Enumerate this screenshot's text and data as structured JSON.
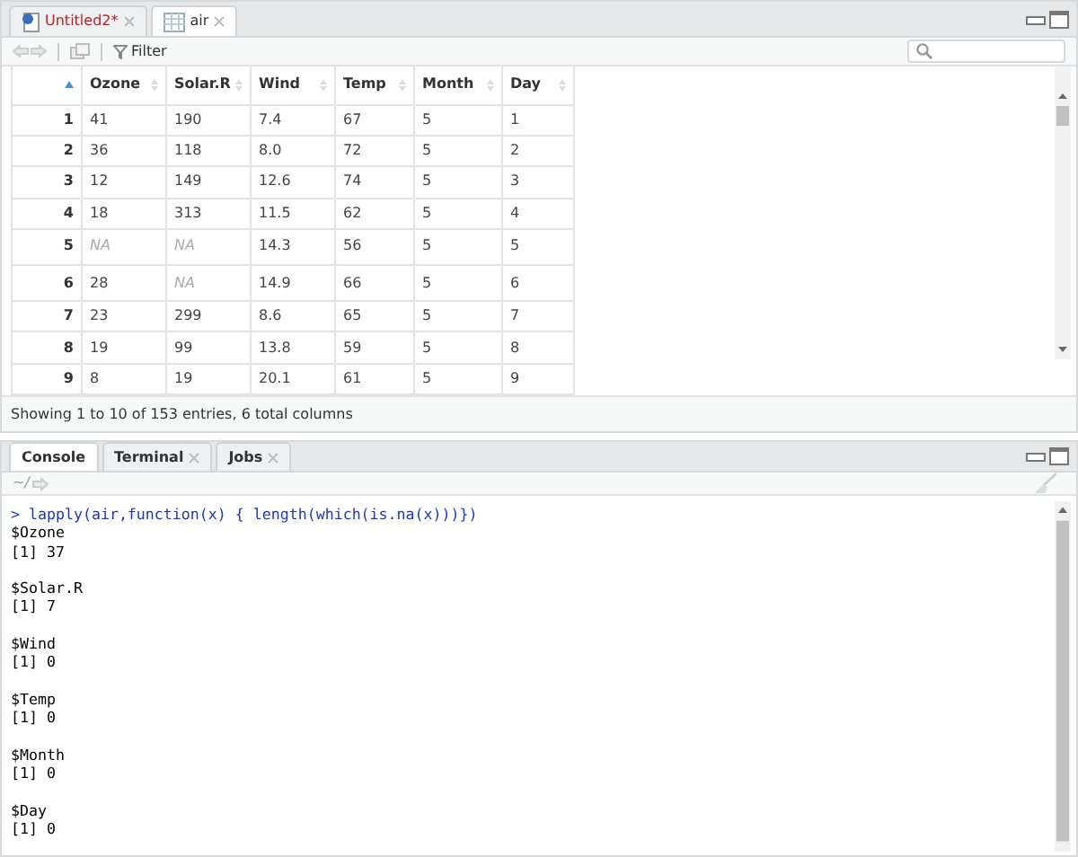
{
  "editor": {
    "tabs": [
      {
        "label": "Untitled2*",
        "kind": "script",
        "modified": true,
        "selected": false
      },
      {
        "label": "air",
        "kind": "data",
        "modified": false,
        "selected": true
      }
    ],
    "toolbar": {
      "filter_label": "Filter"
    },
    "table": {
      "index_column": {
        "sorted": true
      },
      "columns": [
        {
          "label": "Ozone",
          "sorted": false
        },
        {
          "label": "Solar.R",
          "sorted": false
        },
        {
          "label": "Wind",
          "sorted": false
        },
        {
          "label": "Temp",
          "sorted": false
        },
        {
          "label": "Month",
          "sorted": false
        },
        {
          "label": "Day",
          "sorted": false
        }
      ],
      "rows": [
        {
          "index": "1",
          "cells": [
            {
              "value": "41",
              "missing": false
            },
            {
              "value": "190",
              "missing": false
            },
            {
              "value": "7.4",
              "missing": false
            },
            {
              "value": "67",
              "missing": false
            },
            {
              "value": "5",
              "missing": false
            },
            {
              "value": "1",
              "missing": false
            }
          ]
        },
        {
          "index": "2",
          "cells": [
            {
              "value": "36",
              "missing": false
            },
            {
              "value": "118",
              "missing": false
            },
            {
              "value": "8.0",
              "missing": false
            },
            {
              "value": "72",
              "missing": false
            },
            {
              "value": "5",
              "missing": false
            },
            {
              "value": "2",
              "missing": false
            }
          ]
        },
        {
          "index": "3",
          "cells": [
            {
              "value": "12",
              "missing": false
            },
            {
              "value": "149",
              "missing": false
            },
            {
              "value": "12.6",
              "missing": false
            },
            {
              "value": "74",
              "missing": false
            },
            {
              "value": "5",
              "missing": false
            },
            {
              "value": "3",
              "missing": false
            }
          ]
        },
        {
          "index": "4",
          "cells": [
            {
              "value": "18",
              "missing": false
            },
            {
              "value": "313",
              "missing": false
            },
            {
              "value": "11.5",
              "missing": false
            },
            {
              "value": "62",
              "missing": false
            },
            {
              "value": "5",
              "missing": false
            },
            {
              "value": "4",
              "missing": false
            }
          ]
        },
        {
          "index": "5",
          "cells": [
            {
              "value": "NA",
              "missing": true
            },
            {
              "value": "NA",
              "missing": true
            },
            {
              "value": "14.3",
              "missing": false
            },
            {
              "value": "56",
              "missing": false
            },
            {
              "value": "5",
              "missing": false
            },
            {
              "value": "5",
              "missing": false
            }
          ]
        },
        {
          "index": "6",
          "cells": [
            {
              "value": "28",
              "missing": false
            },
            {
              "value": "NA",
              "missing": true
            },
            {
              "value": "14.9",
              "missing": false
            },
            {
              "value": "66",
              "missing": false
            },
            {
              "value": "5",
              "missing": false
            },
            {
              "value": "6",
              "missing": false
            }
          ]
        },
        {
          "index": "7",
          "cells": [
            {
              "value": "23",
              "missing": false
            },
            {
              "value": "299",
              "missing": false
            },
            {
              "value": "8.6",
              "missing": false
            },
            {
              "value": "65",
              "missing": false
            },
            {
              "value": "5",
              "missing": false
            },
            {
              "value": "7",
              "missing": false
            }
          ]
        },
        {
          "index": "8",
          "cells": [
            {
              "value": "19",
              "missing": false
            },
            {
              "value": "99",
              "missing": false
            },
            {
              "value": "13.8",
              "missing": false
            },
            {
              "value": "59",
              "missing": false
            },
            {
              "value": "5",
              "missing": false
            },
            {
              "value": "8",
              "missing": false
            }
          ]
        },
        {
          "index": "9",
          "cells": [
            {
              "value": "8",
              "missing": false
            },
            {
              "value": "19",
              "missing": false
            },
            {
              "value": "20.1",
              "missing": false
            },
            {
              "value": "61",
              "missing": false
            },
            {
              "value": "5",
              "missing": false
            },
            {
              "value": "9",
              "missing": false
            }
          ]
        }
      ]
    },
    "footer": "Showing 1 to 10 of 153 entries, 6 total columns"
  },
  "console": {
    "tabs": [
      {
        "label": "Console",
        "closable": false,
        "selected": true
      },
      {
        "label": "Terminal",
        "closable": true,
        "selected": false
      },
      {
        "label": "Jobs",
        "closable": true,
        "selected": false
      }
    ],
    "path": "~/",
    "prompt": ">",
    "command": "lapply(air,function(x) { length(which(is.na(x)))})",
    "output": [
      {
        "name": "$Ozone",
        "value": "[1] 37"
      },
      {
        "name": "$Solar.R",
        "value": "[1] 7"
      },
      {
        "name": "$Wind",
        "value": "[1] 0"
      },
      {
        "name": "$Temp",
        "value": "[1] 0"
      },
      {
        "name": "$Month",
        "value": "[1] 0"
      },
      {
        "name": "$Day",
        "value": "[1] 0"
      }
    ]
  }
}
